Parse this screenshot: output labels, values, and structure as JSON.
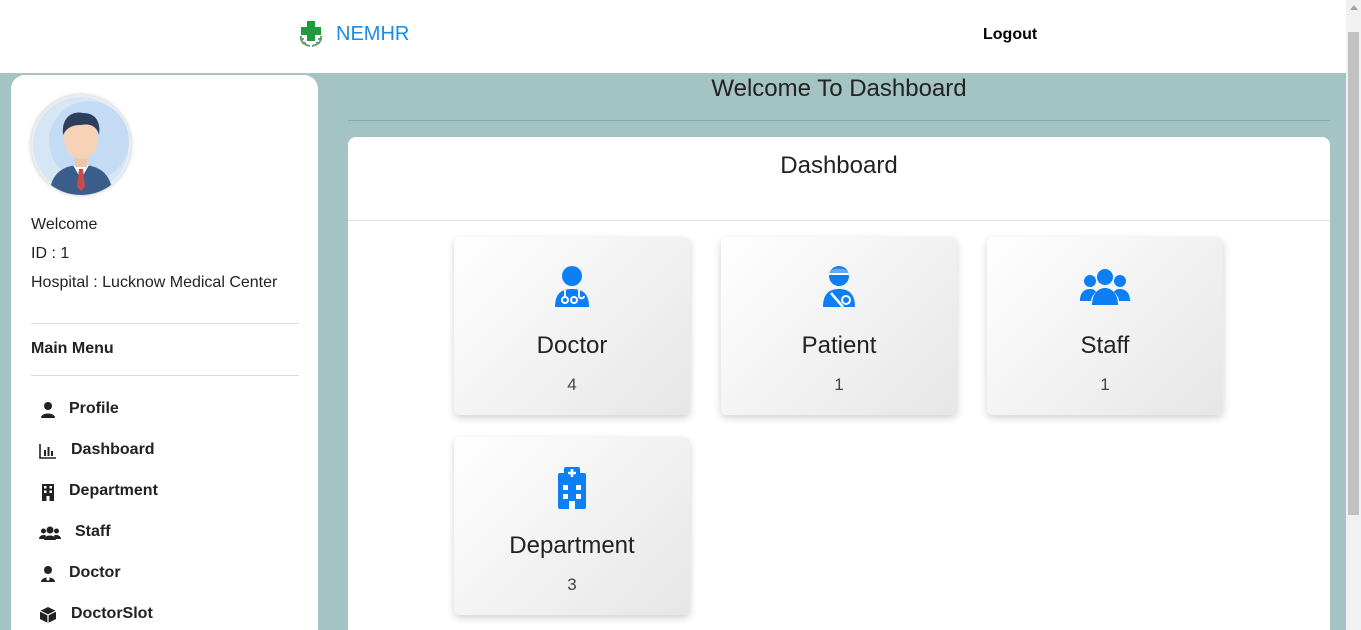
{
  "header": {
    "brand_name": "NEMHR",
    "logo_icon": "medical-cross-logo",
    "logout_label": "Logout",
    "brand_color": "#1a8be8"
  },
  "sidebar": {
    "avatar_icon": "user-avatar",
    "welcome": "Welcome",
    "id_line": "ID : 1",
    "hospital_line": "Hospital : Lucknow Medical Center",
    "menu_title": "Main Menu",
    "items": [
      {
        "label": "Profile",
        "icon": "user-icon"
      },
      {
        "label": "Dashboard",
        "icon": "chart-bar-icon"
      },
      {
        "label": "Department",
        "icon": "building-icon"
      },
      {
        "label": "Staff",
        "icon": "users-icon"
      },
      {
        "label": "Doctor",
        "icon": "doctor-icon"
      },
      {
        "label": "DoctorSlot",
        "icon": "box-icon"
      }
    ]
  },
  "main": {
    "page_title": "Welcome To Dashboard",
    "panel_title": "Dashboard",
    "accent_color": "#0d7ff5",
    "cards": [
      {
        "label": "Doctor",
        "count": "4",
        "icon": "user-doctor-icon"
      },
      {
        "label": "Patient",
        "count": "1",
        "icon": "user-injured-icon"
      },
      {
        "label": "Staff",
        "count": "1",
        "icon": "users-icon"
      },
      {
        "label": "Department",
        "count": "3",
        "icon": "hospital-icon"
      }
    ]
  }
}
